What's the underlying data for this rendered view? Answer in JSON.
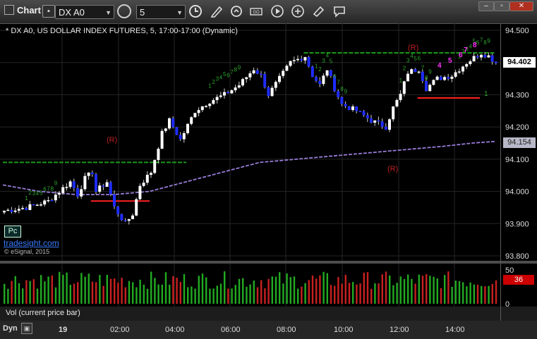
{
  "toolbar": {
    "title": "Chart",
    "symbol": "DX A0",
    "interval": "5",
    "tool_icons": [
      "clock-icon",
      "pencil-icon",
      "refresh-icon",
      "ticker-icon",
      "play-icon",
      "link-icon",
      "message-icon"
    ]
  },
  "chart": {
    "title": "* DX A0, US DOLLAR INDEX FUTURES, 5, 17:00-17:00 (Dynamic)",
    "site": "tradesight.com",
    "copyright": "© eSignal, 2015",
    "badge": "Pc",
    "last_price": "94.402",
    "ma_value": "94.154",
    "colors": {
      "up": "#ffffff",
      "down": "#1e2cff",
      "ma": "#9a7bd8",
      "red_line": "#ff2020",
      "green_line": "#1a9a1a",
      "counter": "#2ea62e",
      "counter_high": "#ff33ff"
    },
    "y_labels": [
      "94.500",
      "94.400",
      "94.300",
      "94.200",
      "94.100",
      "94.000",
      "93.900",
      "93.800"
    ],
    "x_labels": [
      "19",
      "02:00",
      "04:00",
      "06:00",
      "08:00",
      "10:00",
      "12:00",
      "14:00"
    ],
    "annotations": {
      "r_labels": [
        "(R)",
        "(R)",
        "(R)"
      ],
      "magenta_counts": [
        "4",
        "5",
        "6",
        "7",
        "8"
      ],
      "green_count_end": "1"
    }
  },
  "volume": {
    "label": "Vol (current price bar)",
    "y_labels": [
      "50",
      "0"
    ],
    "current": "36"
  },
  "footer": {
    "dyn": "Dyn"
  },
  "chart_data": {
    "type": "candlestick",
    "title": "* DX A0, US DOLLAR INDEX FUTURES, 5, 17:00-17:00 (Dynamic)",
    "ylim": [
      93.8,
      94.5
    ],
    "x_ticks": [
      "19",
      "02:00",
      "04:00",
      "06:00",
      "08:00",
      "10:00",
      "12:00",
      "14:00"
    ],
    "path": [
      [
        0,
        93.94
      ],
      [
        6,
        93.95
      ],
      [
        12,
        93.97
      ],
      [
        16,
        94.01
      ],
      [
        18,
        94.03
      ],
      [
        20,
        93.99
      ],
      [
        22,
        94.04
      ],
      [
        24,
        94.06
      ],
      [
        25,
        94.0
      ],
      [
        28,
        94.03
      ],
      [
        30,
        93.95
      ],
      [
        33,
        93.9
      ],
      [
        35,
        93.93
      ],
      [
        37,
        94.02
      ],
      [
        40,
        94.06
      ],
      [
        43,
        94.18
      ],
      [
        45,
        94.22
      ],
      [
        48,
        94.16
      ],
      [
        52,
        94.25
      ],
      [
        56,
        94.28
      ],
      [
        60,
        94.3
      ],
      [
        64,
        94.33
      ],
      [
        68,
        94.38
      ],
      [
        70,
        94.36
      ],
      [
        72,
        94.3
      ],
      [
        75,
        94.35
      ],
      [
        78,
        94.4
      ],
      [
        82,
        94.42
      ],
      [
        84,
        94.36
      ],
      [
        86,
        94.33
      ],
      [
        88,
        94.38
      ],
      [
        90,
        94.32
      ],
      [
        92,
        94.27
      ],
      [
        96,
        94.25
      ],
      [
        100,
        94.22
      ],
      [
        104,
        94.2
      ],
      [
        106,
        94.26
      ],
      [
        108,
        94.3
      ],
      [
        110,
        94.37
      ],
      [
        113,
        94.38
      ],
      [
        115,
        94.32
      ],
      [
        118,
        94.35
      ],
      [
        122,
        94.36
      ],
      [
        126,
        94.4
      ],
      [
        130,
        94.43
      ],
      [
        132,
        94.42
      ],
      [
        134,
        94.4
      ]
    ],
    "moving_average": [
      [
        0,
        94.02
      ],
      [
        10,
        94.0
      ],
      [
        20,
        93.99
      ],
      [
        30,
        93.99
      ],
      [
        40,
        94.0
      ],
      [
        50,
        94.03
      ],
      [
        60,
        94.06
      ],
      [
        70,
        94.09
      ],
      [
        80,
        94.1
      ],
      [
        90,
        94.11
      ],
      [
        100,
        94.12
      ],
      [
        110,
        94.13
      ],
      [
        120,
        94.14
      ],
      [
        128,
        94.15
      ],
      [
        134,
        94.155
      ]
    ],
    "hlines": [
      {
        "color": "green",
        "y": 94.09,
        "x0": 0,
        "x1": 50
      },
      {
        "color": "red",
        "y": 93.97,
        "x0": 24,
        "x1": 40
      },
      {
        "color": "green",
        "y": 94.43,
        "x0": 82,
        "x1": 134
      },
      {
        "color": "red",
        "y": 94.29,
        "x0": 113,
        "x1": 130
      }
    ],
    "volume_max": 50,
    "last_volume": 36
  }
}
